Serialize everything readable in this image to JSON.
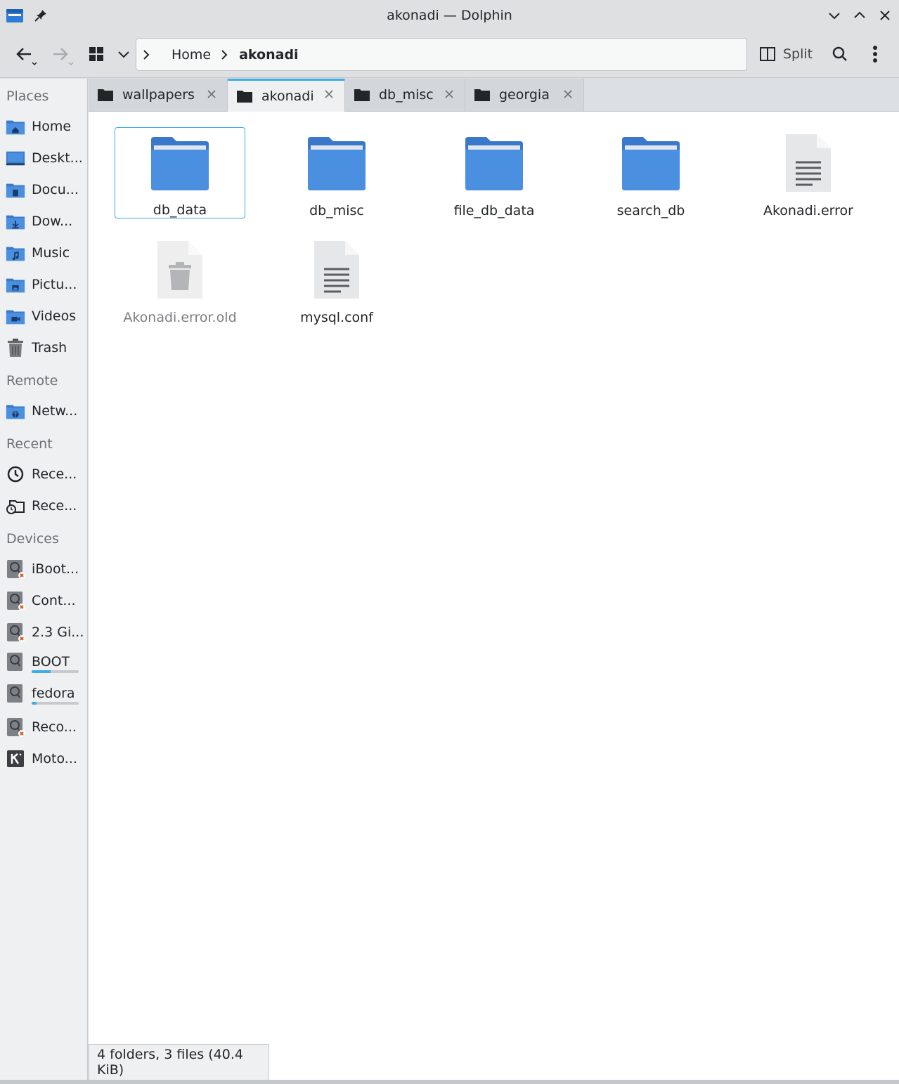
{
  "window": {
    "title": "akonadi — Dolphin"
  },
  "toolbar": {
    "breadcrumb": [
      {
        "label": "Home"
      }
    ],
    "current_folder": "akonadi",
    "split_label": "Split"
  },
  "sidebar": {
    "sections": {
      "places": "Places",
      "remote": "Remote",
      "recent": "Recent",
      "devices": "Devices"
    },
    "places": [
      {
        "label": "Home",
        "icon": "home-folder-icon"
      },
      {
        "label": "Deskt...",
        "icon": "desktop-icon"
      },
      {
        "label": "Docu...",
        "icon": "documents-folder-icon"
      },
      {
        "label": "Dow...",
        "icon": "downloads-folder-icon"
      },
      {
        "label": "Music",
        "icon": "music-folder-icon"
      },
      {
        "label": "Pictu...",
        "icon": "pictures-folder-icon"
      },
      {
        "label": "Videos",
        "icon": "videos-folder-icon"
      },
      {
        "label": "Trash",
        "icon": "trash-icon"
      }
    ],
    "remote": [
      {
        "label": "Netw...",
        "icon": "network-folder-icon"
      }
    ],
    "recent": [
      {
        "label": "Rece...",
        "icon": "clock-icon"
      },
      {
        "label": "Rece...",
        "icon": "recent-locations-icon"
      }
    ],
    "devices": [
      {
        "label": "iBoot...",
        "icon": "drive-unmounted-icon"
      },
      {
        "label": "Cont...",
        "icon": "drive-unmounted-icon"
      },
      {
        "label": "2.3 Gi...",
        "icon": "drive-unmounted-icon"
      },
      {
        "label": "BOOT",
        "icon": "drive-icon",
        "usage": 0.4
      },
      {
        "label": "fedora",
        "icon": "drive-icon",
        "usage": 0.1
      },
      {
        "label": "Reco...",
        "icon": "drive-unmounted-icon"
      },
      {
        "label": "Moto...",
        "icon": "phone-device-icon"
      }
    ]
  },
  "tabs": [
    {
      "label": "wallpapers",
      "active": false
    },
    {
      "label": "akonadi",
      "active": true
    },
    {
      "label": "db_misc",
      "active": false
    },
    {
      "label": "georgia",
      "active": false
    }
  ],
  "files": [
    {
      "name": "db_data",
      "type": "folder",
      "selected": true
    },
    {
      "name": "db_misc",
      "type": "folder"
    },
    {
      "name": "file_db_data",
      "type": "folder"
    },
    {
      "name": "search_db",
      "type": "folder"
    },
    {
      "name": "Akonadi.error",
      "type": "text"
    },
    {
      "name": "Akonadi.error.old",
      "type": "trash-file"
    },
    {
      "name": "mysql.conf",
      "type": "text"
    }
  ],
  "status": "4 folders, 3 files (40.4 KiB)",
  "colors": {
    "accent": "#3daee9",
    "folder": "#4a8fe0",
    "folder_tab": "#3a79c9"
  }
}
